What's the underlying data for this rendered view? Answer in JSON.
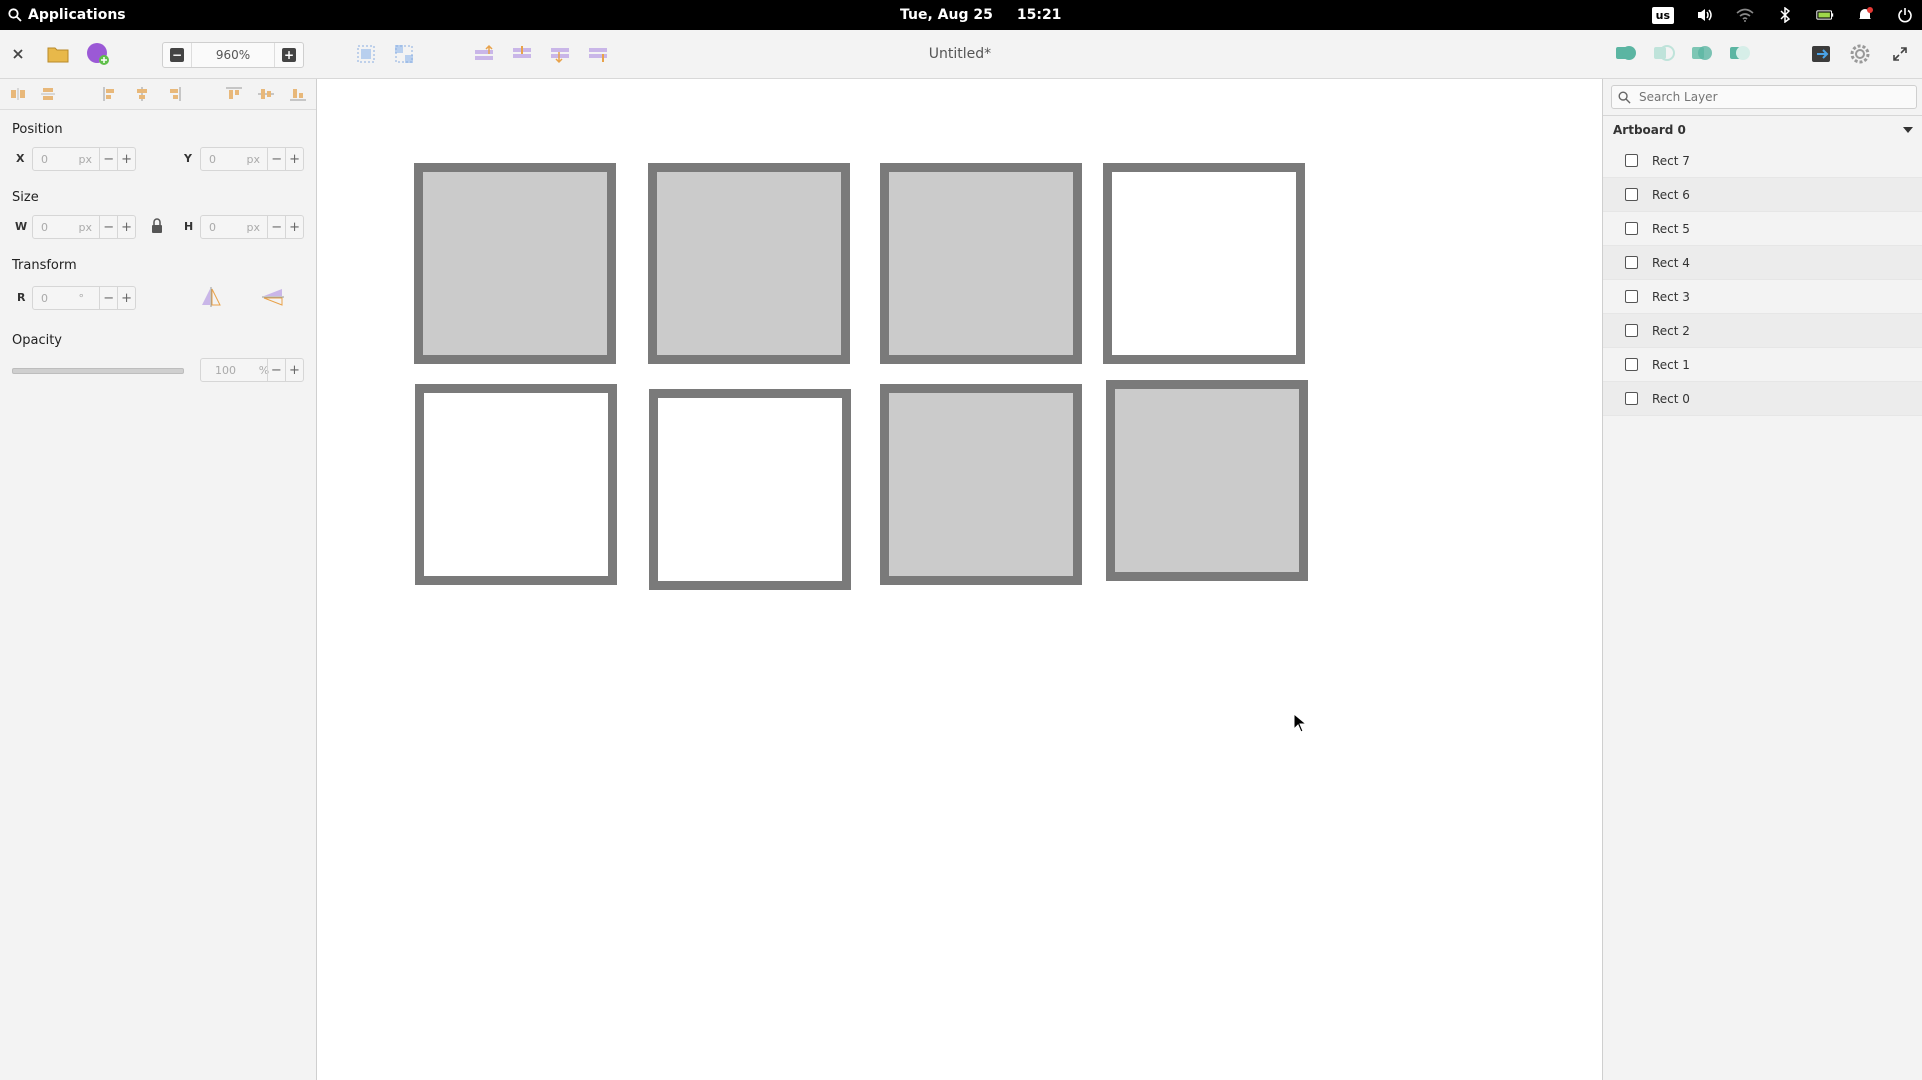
{
  "topbar": {
    "applications_label": "Applications",
    "date": "Tue, Aug 25",
    "time": "15:21",
    "keyboard_layout": "us"
  },
  "header": {
    "zoom_value": "960%",
    "document_title": "Untitled*"
  },
  "left_panel": {
    "position_label": "Position",
    "x_label": "X",
    "x_value": "0",
    "x_unit": "px",
    "y_label": "Y",
    "y_value": "0",
    "y_unit": "px",
    "size_label": "Size",
    "w_label": "W",
    "w_value": "0",
    "w_unit": "px",
    "h_label": "H",
    "h_value": "0",
    "h_unit": "px",
    "transform_label": "Transform",
    "r_label": "R",
    "r_value": "0",
    "r_unit": "°",
    "opacity_label": "Opacity",
    "opacity_value": "100",
    "opacity_unit": "%",
    "minus": "−",
    "plus": "+"
  },
  "right_panel": {
    "search_placeholder": "Search Layer",
    "artboard_name": "Artboard 0",
    "layers": [
      "Rect 7",
      "Rect 6",
      "Rect 5",
      "Rect 4",
      "Rect 3",
      "Rect 2",
      "Rect 1",
      "Rect 0"
    ]
  },
  "canvas": {
    "rect_fill_gray": "#cbcbcb",
    "rect_fill_white": "#ffffff",
    "rect_border": "#7a7a7a"
  },
  "colors": {
    "accent": "#5bb5a2",
    "purple": "#9b59d6"
  }
}
